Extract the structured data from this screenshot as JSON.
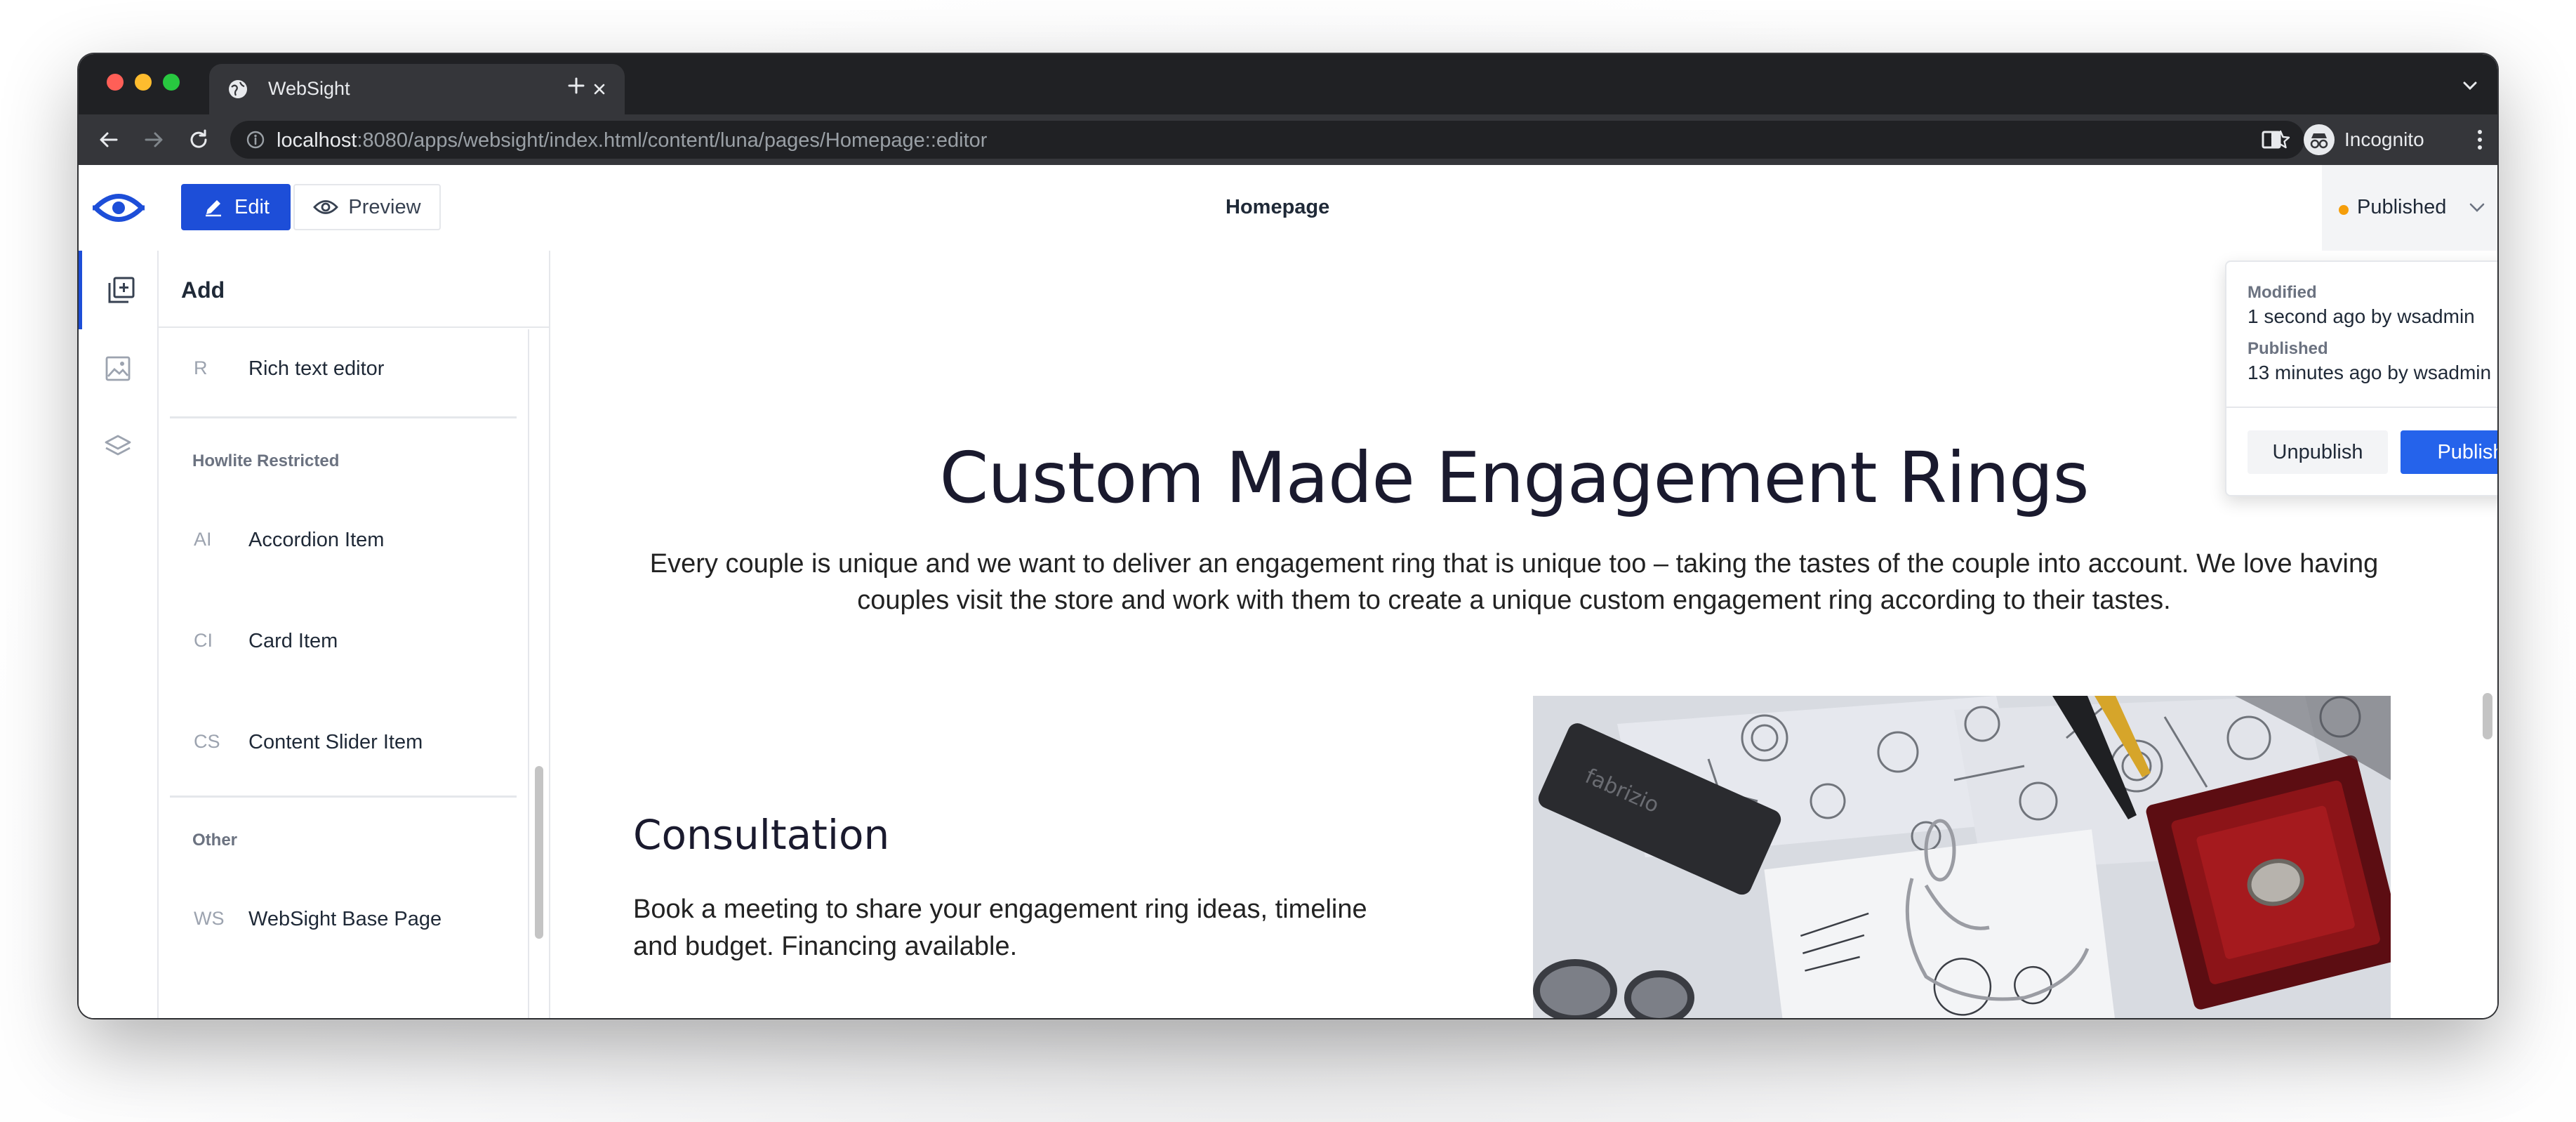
{
  "browser": {
    "tab_title": "WebSight",
    "url_host": "localhost",
    "url_rest": ":8080/apps/websight/index.html/content/luna/pages/Homepage::editor",
    "profile_label": "Incognito"
  },
  "header": {
    "edit_label": "Edit",
    "preview_label": "Preview",
    "page_title": "Homepage",
    "status_label": "Published",
    "accent": "#1d4ed8",
    "status_color": "#f59e0b"
  },
  "rail": {
    "items": [
      {
        "icon": "add-component-icon",
        "active": true
      },
      {
        "icon": "assets-image-icon",
        "active": false
      },
      {
        "icon": "layers-icon",
        "active": false
      }
    ]
  },
  "panel": {
    "title": "Add",
    "item_rich_text": {
      "abbr": "R",
      "name": "Rich text editor"
    },
    "group_howlite": "Howlite Restricted",
    "item_accordion": {
      "abbr": "AI",
      "name": "Accordion Item"
    },
    "item_card": {
      "abbr": "CI",
      "name": "Card Item"
    },
    "item_slider": {
      "abbr": "CS",
      "name": "Content Slider Item"
    },
    "group_other": "Other",
    "item_base_page": {
      "abbr": "WS",
      "name": "WebSight Base Page"
    }
  },
  "canvas": {
    "hero_title": "Custom Made Engagement Rings",
    "hero_text": "Every couple is unique and we want to deliver an engagement ring that is unique too – taking the tastes of the couple into account. We love having couples visit the store and work with them to create a unique custom engagement ring according to their tastes.",
    "section_title": "Consultation",
    "section_text": "Book a meeting to share your engagement ring ideas, timeline and budget. Financing available."
  },
  "popover": {
    "modified_label": "Modified",
    "modified_value": "1 second ago by wsadmin",
    "published_label": "Published",
    "published_value": "13 minutes ago by wsadmin",
    "unpublish_label": "Unpublish",
    "publish_label": "Publish",
    "publish_color": "#2563eb"
  }
}
